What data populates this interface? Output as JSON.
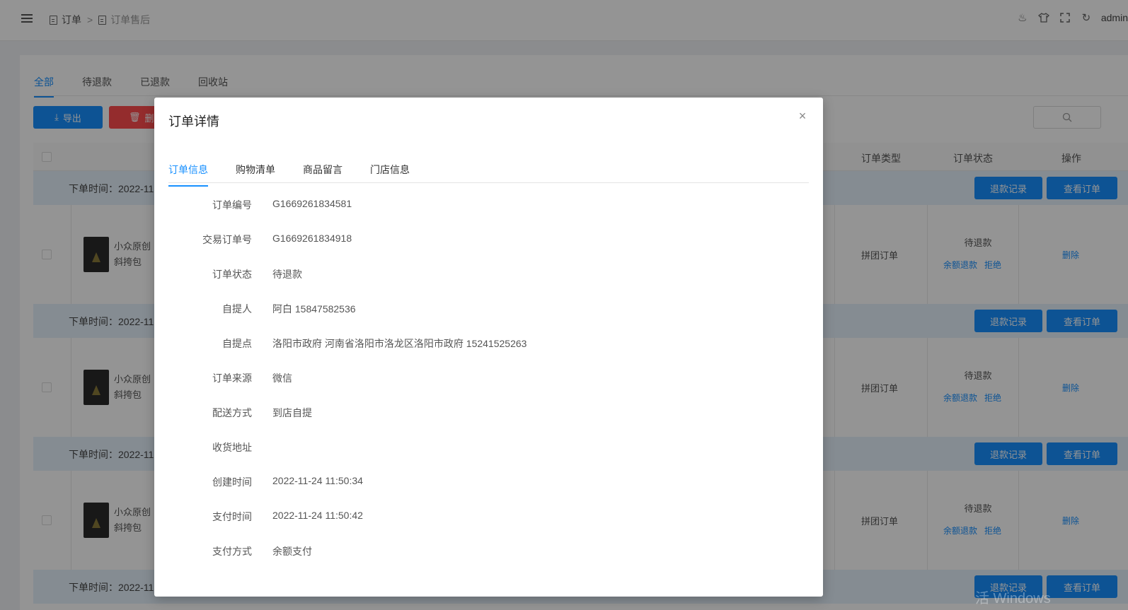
{
  "header": {
    "breadcrumb": [
      {
        "label": "订单"
      },
      {
        "label": "订单售后"
      }
    ],
    "separator": ">",
    "user": "admin"
  },
  "page": {
    "tabs": [
      {
        "label": "全部",
        "active": true
      },
      {
        "label": "待退款",
        "active": false
      },
      {
        "label": "已退款",
        "active": false
      },
      {
        "label": "回收站",
        "active": false
      }
    ],
    "export_label": "导出",
    "delete_label": "删",
    "table_headers": {
      "order_type": "订单类型",
      "order_status": "订单状态",
      "actions": "操作"
    },
    "orders": [
      {
        "time_label": "下单时间：2022-11-",
        "refund_record": "退款记录",
        "view_order": "查看订单",
        "product_name": "小众原创",
        "product_sub": "斜挎包",
        "type": "拼团订单",
        "status": "待退款",
        "balance_refund": "余额退款",
        "reject": "拒绝",
        "delete": "删除"
      },
      {
        "time_label": "下单时间：2022-11-",
        "refund_record": "退款记录",
        "view_order": "查看订单",
        "product_name": "小众原创",
        "product_sub": "斜挎包",
        "type": "拼团订单",
        "status": "待退款",
        "balance_refund": "余额退款",
        "reject": "拒绝",
        "delete": "删除"
      },
      {
        "time_label": "下单时间：2022-11-",
        "refund_record": "退款记录",
        "view_order": "查看订单",
        "product_name": "小众原创",
        "product_sub": "斜挎包",
        "type": "拼团订单",
        "status": "待退款",
        "balance_refund": "余额退款",
        "reject": "拒绝",
        "delete": "删除"
      },
      {
        "time_label": "下单时间：2022-11-",
        "refund_record": "退款记录",
        "view_order": "查看订单"
      }
    ]
  },
  "watermark": "活 Windows",
  "modal": {
    "title": "订单详情",
    "close": "×",
    "tabs": [
      {
        "label": "订单信息",
        "active": true
      },
      {
        "label": "购物清单",
        "active": false
      },
      {
        "label": "商品留言",
        "active": false
      },
      {
        "label": "门店信息",
        "active": false
      }
    ],
    "fields": [
      {
        "label": "订单编号",
        "value": "G1669261834581"
      },
      {
        "label": "交易订单号",
        "value": "G1669261834918"
      },
      {
        "label": "订单状态",
        "value": "待退款"
      },
      {
        "label": "自提人",
        "value": "阿白 15847582536"
      },
      {
        "label": "自提点",
        "value": "洛阳市政府 河南省洛阳市洛龙区洛阳市政府 15241525263"
      },
      {
        "label": "订单来源",
        "value": "微信"
      },
      {
        "label": "配送方式",
        "value": "到店自提"
      },
      {
        "label": "收货地址",
        "value": ""
      },
      {
        "label": "创建时间",
        "value": "2022-11-24 11:50:34"
      },
      {
        "label": "支付时间",
        "value": "2022-11-24 11:50:42"
      },
      {
        "label": "支付方式",
        "value": "余额支付"
      }
    ]
  }
}
